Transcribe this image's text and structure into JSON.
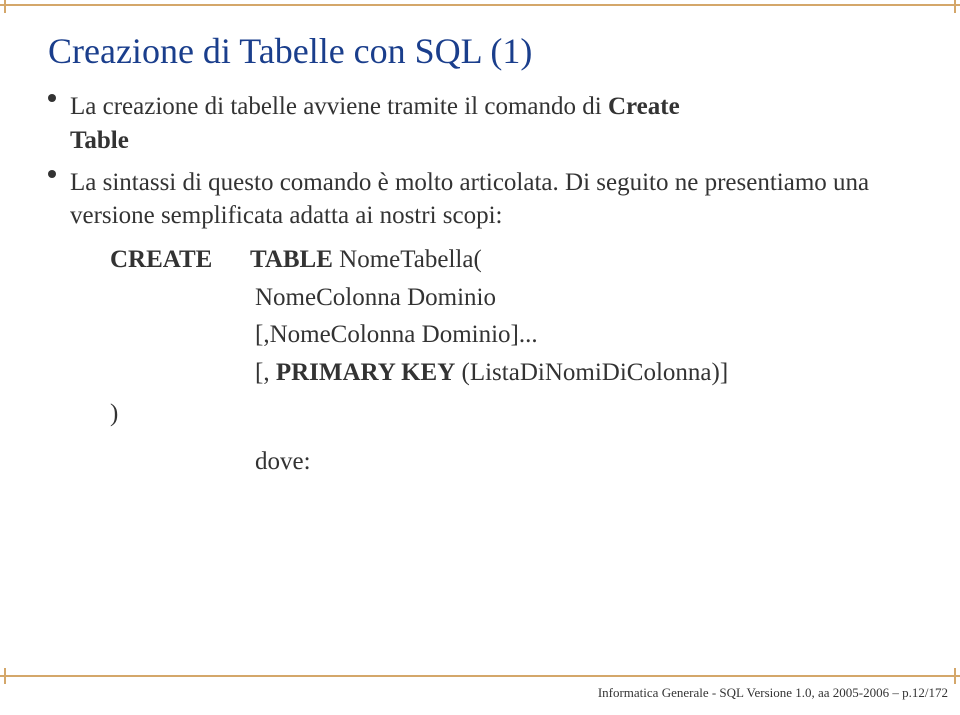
{
  "title": "Creazione di Tabelle con SQL (1)",
  "bullet1_prefix": "La creazione di tabelle avviene tramite il comando di ",
  "bullet1_bold1": "Create",
  "bullet1_bold2": "Table",
  "bullet2": "La sintassi di questo comando è molto articolata. Di seguito ne presentiamo una versione semplificata adatta ai nostri scopi:",
  "code": {
    "create": "CREATE",
    "line1_a": "TABLE",
    "line1_b": " NomeTabella(",
    "line2": "NomeColonna Dominio",
    "line3": "[,NomeColonna Dominio]...",
    "line4_a": "[, ",
    "line4_b": "PRIMARY KEY",
    "line4_c": " (ListaDiNomiDiColonna)]",
    "paren": ")",
    "dove": "dove:"
  },
  "footer": "Informatica Generale - SQL Versione 1.0, aa 2005-2006 – p.12/172"
}
